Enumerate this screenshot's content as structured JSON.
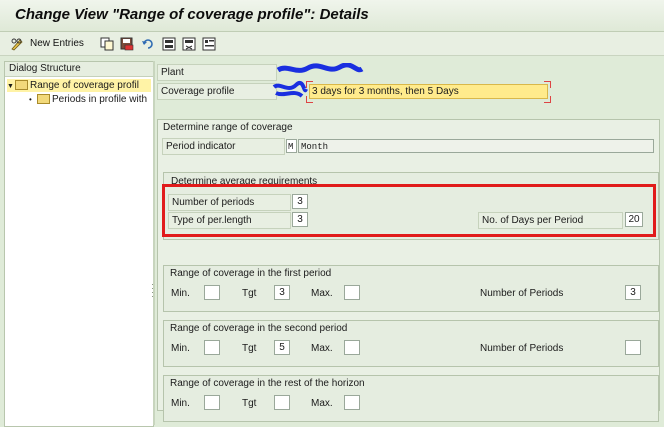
{
  "title": "Change View \"Range of coverage profile\": Details",
  "toolbar": {
    "new_entries_label": "New Entries",
    "icons": [
      "pencil-glasses-icon",
      "copy-icon",
      "save-as-icon",
      "undo-icon",
      "select-all-icon",
      "deselect-icon",
      "variant-icon"
    ]
  },
  "dialog_structure": {
    "header": "Dialog Structure",
    "items": [
      {
        "label": "Range of coverage profil",
        "selected": true,
        "expanded": true
      },
      {
        "label": "Periods in profile with",
        "selected": false
      }
    ]
  },
  "header_fields": {
    "plant_label": "Plant",
    "coverage_profile_label": "Coverage profile",
    "coverage_profile_value": "3 days for 3 months, then 5 Days"
  },
  "determine_range": {
    "title": "Determine range of coverage",
    "period_indicator_label": "Period indicator",
    "period_indicator_code": "M",
    "period_indicator_text": "Month"
  },
  "average_requirements": {
    "title": "Determine average requirements",
    "num_periods_label": "Number of periods",
    "num_periods_value": "3",
    "type_per_length_label": "Type of per.length",
    "type_per_length_value": "3",
    "days_per_period_label": "No. of Days per Period",
    "days_per_period_value": "20"
  },
  "first_period": {
    "title": "Range of coverage in the first period",
    "min_label": "Min.",
    "min_value": "",
    "tgt_label": "Tgt",
    "tgt_value": "3",
    "max_label": "Max.",
    "max_value": "",
    "num_periods_label": "Number of Periods",
    "num_periods_value": "3"
  },
  "second_period": {
    "title": "Range of coverage in the second period",
    "min_label": "Min.",
    "min_value": "",
    "tgt_label": "Tgt",
    "tgt_value": "5",
    "max_label": "Max.",
    "max_value": "",
    "num_periods_label": "Number of Periods",
    "num_periods_value": ""
  },
  "rest_horizon": {
    "title": "Range of coverage in the rest of the horizon",
    "min_label": "Min.",
    "min_value": "",
    "tgt_label": "Tgt",
    "tgt_value": "",
    "max_label": "Max.",
    "max_value": ""
  },
  "colors": {
    "highlight_frame": "#e11b1b",
    "sap_green": "#dfebd8",
    "selected_field": "#ffeb8c"
  }
}
